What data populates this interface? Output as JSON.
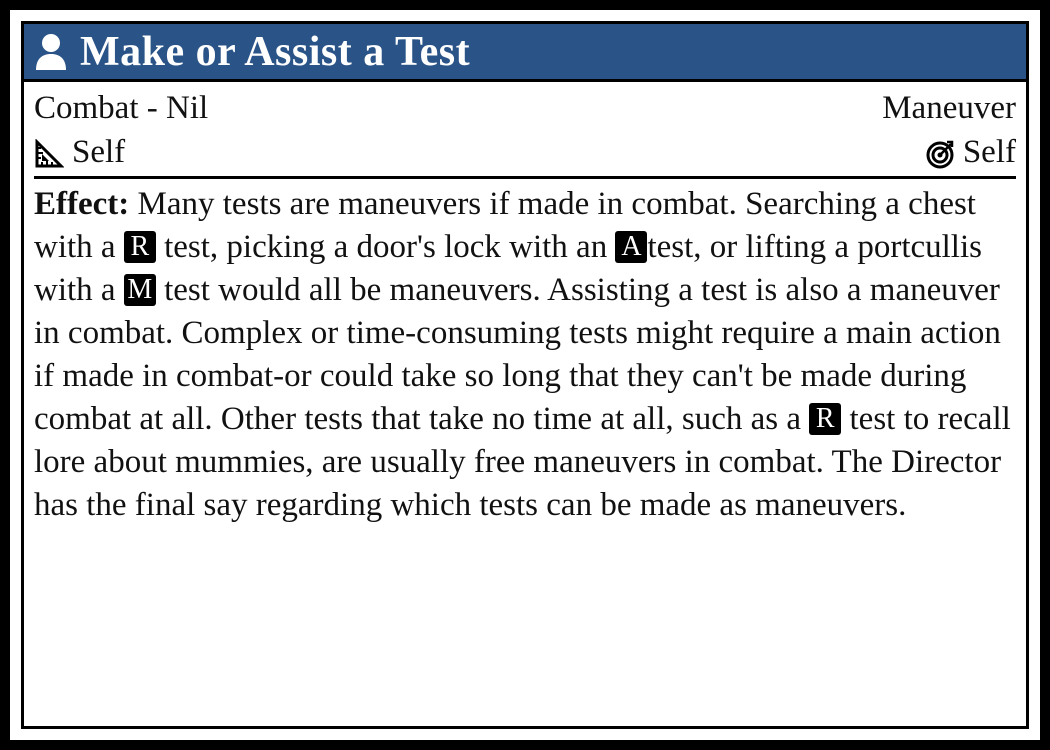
{
  "card": {
    "title": "Make or Assist a Test",
    "title_icon": "person-icon",
    "accent_color": "#2a5488"
  },
  "meta": {
    "keywords": "Combat - Nil",
    "type": "Maneuver",
    "distance_icon": "ruler-triangle-icon",
    "distance": "Self",
    "target_icon": "target-icon",
    "target": "Self"
  },
  "effect": {
    "label": "Effect:",
    "p1": " Many tests are maneuvers if made in combat. Searching a chest with a ",
    "badge1": "R",
    "p2": " test, picking a door's lock with an ",
    "badge2": "A",
    "p3": "test, or lifting a portcullis with a ",
    "badge3": "M",
    "p4": " test would all be maneuvers. Assisting a test is also a maneuver in combat. Complex or time-consuming tests might require a main action if made in combat-or could take so long that they can't be made during combat at all. Other tests that take no time at all, such as a ",
    "badge4": "R",
    "p5": " test to recall lore about mummies, are usually free maneuvers in combat. The Director has the final say regarding which tests can be made as maneuvers."
  }
}
